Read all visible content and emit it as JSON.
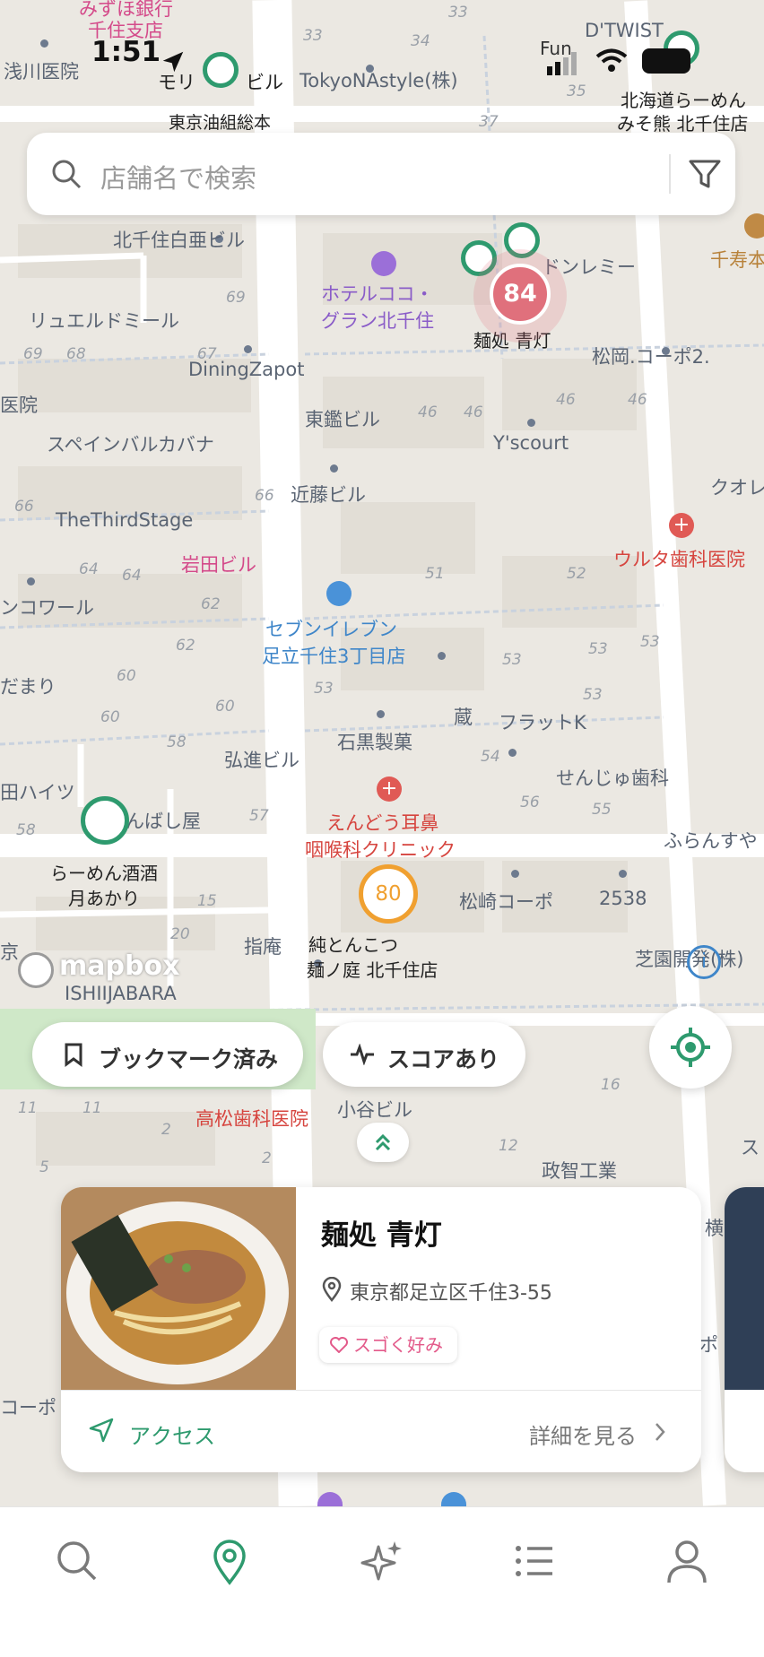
{
  "status_bar": {
    "time": "1:51",
    "carrier": "Fun"
  },
  "search": {
    "placeholder": "店舗名で検索"
  },
  "map": {
    "labels": {
      "bank1": "みずほ銀行",
      "bank2": "千住支店",
      "asakawa": "浅川医院",
      "mori_bldg": "モリ",
      "bldg": "ビル",
      "tokyo_na": "TokyoNAstyle(株)",
      "dtwist": "D'TWIST",
      "hokkaido1": "北海道らーめん",
      "hokkaido2": "みそ熊 北千住店",
      "tokyo_oil": "東京油組総本",
      "kita_senju_hakua": "北千住白亜ビル",
      "hotel1": "ホテルココ・",
      "hotel2": "グラン北千住",
      "donremi": "ドンレミー",
      "chijumoto": "千寿本",
      "riyueru": "リュエルドミール",
      "dining": "DiningZapot",
      "aoi_store": "麺処 青灯",
      "matsuoka": "松岡.コーポ2.",
      "iin": "医院",
      "toukan": "東鑑ビル",
      "spain": "スペインバルカバナ",
      "yscourt": "Y'scourt",
      "kondo": "近藤ビル",
      "kuore": "クオレ",
      "third": "TheThirdStage",
      "iwata": "岩田ビル",
      "uruta": "ウルタ歯科医院",
      "sevenA": "セブンイレブン",
      "sevenB": "足立千住3丁目店",
      "kowaaru": "ンコワール",
      "damari": "だまり",
      "kura": "蔵",
      "flatk": "フラットK",
      "ishiguro": "石黒製菓",
      "kosin": "弘進ビル",
      "senju_shika": "せんじゅ歯科",
      "haitsu": "田ハイツ",
      "bashiya": "んばし屋",
      "endo1": "えんどう耳鼻",
      "endo2": "咽喉科クリニック",
      "furansu": "ふらんすや",
      "tsuki1": "らーめん酒酒",
      "tsuki2": "月あかり",
      "matsuzaki": "松崎コーポ",
      "n2538": "2538",
      "shian": "指庵",
      "jun1": "純とんこつ",
      "jun2": "麺ノ庭 北千住店",
      "shibazono": "芝園開発(株)",
      "kyo": "京",
      "mapbox": "mapbox",
      "ishii": "ISHIIJABARA",
      "takamatsu": "高松歯科医院",
      "kotani": "小谷ビル",
      "seichi": "政智工業",
      "yoko": "横",
      "po": "ポ",
      "ko": "コーポ",
      "su": "ス"
    },
    "scores": {
      "red": "84",
      "orange": "80"
    }
  },
  "filters": {
    "bookmarked": "ブックマーク済み",
    "scored": "スコアあり"
  },
  "card": {
    "name": "麺処 青灯",
    "address": "東京都足立区千住3-55",
    "tag": "スゴく好み",
    "access": "アクセス",
    "detail": "詳細を見る"
  },
  "colors": {
    "accent": "#2e9a6e",
    "score_red": "#e0707c",
    "score_orange": "#f0a030"
  }
}
